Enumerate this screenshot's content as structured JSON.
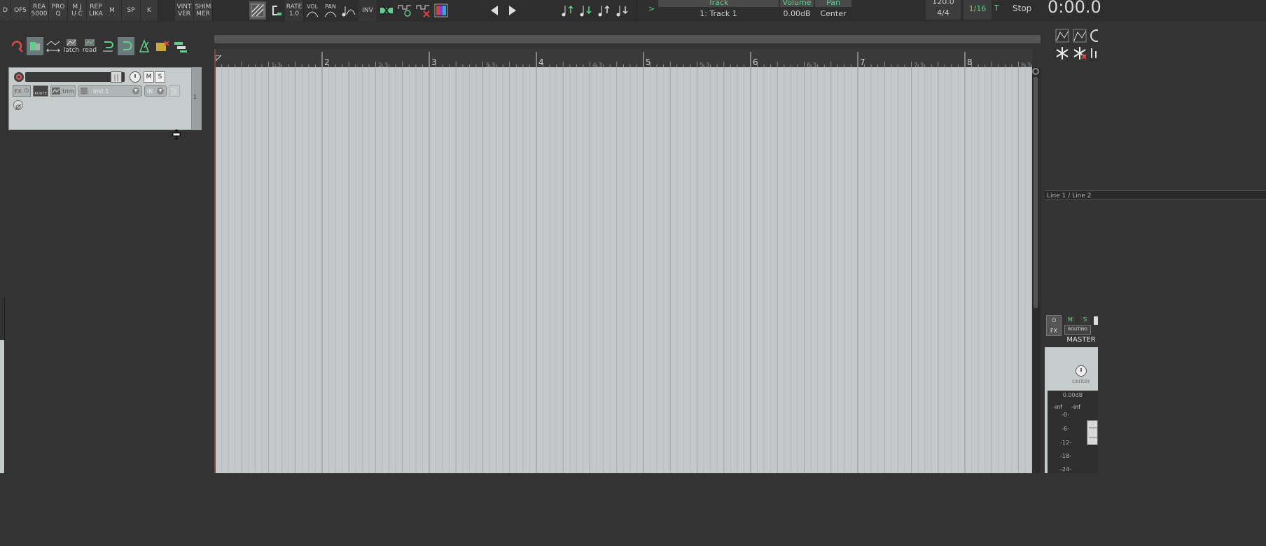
{
  "toolbar_left": [
    {
      "id": "d",
      "label": "D"
    },
    {
      "id": "ofs",
      "label": "OFS"
    },
    {
      "id": "rea5000",
      "label": "REA\n5000"
    },
    {
      "id": "proq",
      "label": "PRO\nQ"
    },
    {
      "id": "mjuc",
      "label": "M J\nU C"
    },
    {
      "id": "replika",
      "label": "REP\nLIKA"
    },
    {
      "id": "m",
      "label": "M"
    },
    {
      "id": "sp",
      "label": "SP"
    },
    {
      "id": "k",
      "label": "K"
    },
    {
      "id": "vintver",
      "label": "VINT\nVER"
    },
    {
      "id": "shimmer",
      "label": "SHIM\nMER"
    }
  ],
  "toolbar_mid": {
    "rate_label": "RATE",
    "rate_value": "1.0",
    "vol_label": "VOL",
    "pan_label": "PAN",
    "inv_label": "INV"
  },
  "track_info": {
    "arrow": ">",
    "track_header": "Track",
    "track_value": "1: Track 1",
    "volume_header": "Volume",
    "volume_value": "0.00dB",
    "pan_header": "Pan",
    "pan_value": "Center"
  },
  "transport": {
    "tempo": "120.0",
    "timesig": "4/4",
    "grid": "1/16",
    "t_label": "T",
    "state": "Stop",
    "time": "0:00.0"
  },
  "edit_toolbar": {
    "latch_label": "latch",
    "read_label": "read"
  },
  "track": {
    "mute_label": "M",
    "solo_label": "S",
    "fx_label": "FX",
    "route_label": "ROUTE",
    "trim_label": "trim",
    "input_label": "Inst 1",
    "in_label": "IN",
    "number": "1"
  },
  "ruler": {
    "bars": [
      "2",
      "3",
      "4",
      "5",
      "6",
      "7",
      "8"
    ],
    "subs": [
      "1.3",
      "2.3",
      "3.3",
      "4.3",
      "5.3",
      "6.3",
      "7.3",
      "8.3"
    ]
  },
  "mixer": {
    "routing_label": "Line 1 / Line 2",
    "fx_label": "FX",
    "m_label": "M",
    "s_label": "S",
    "routing_button": "ROUTING",
    "master_label": "MASTER",
    "pan_label": "center",
    "db_value": "0.00dB",
    "peak_l": "-inf",
    "peak_r": "-inf",
    "scale": [
      "-0-",
      "-6-",
      "-12-",
      "-18-",
      "-24-"
    ]
  },
  "colors": {
    "accent_green": "#5fd08a",
    "arrange_bg": "#c4c8c8",
    "panel_bg": "#333333"
  }
}
